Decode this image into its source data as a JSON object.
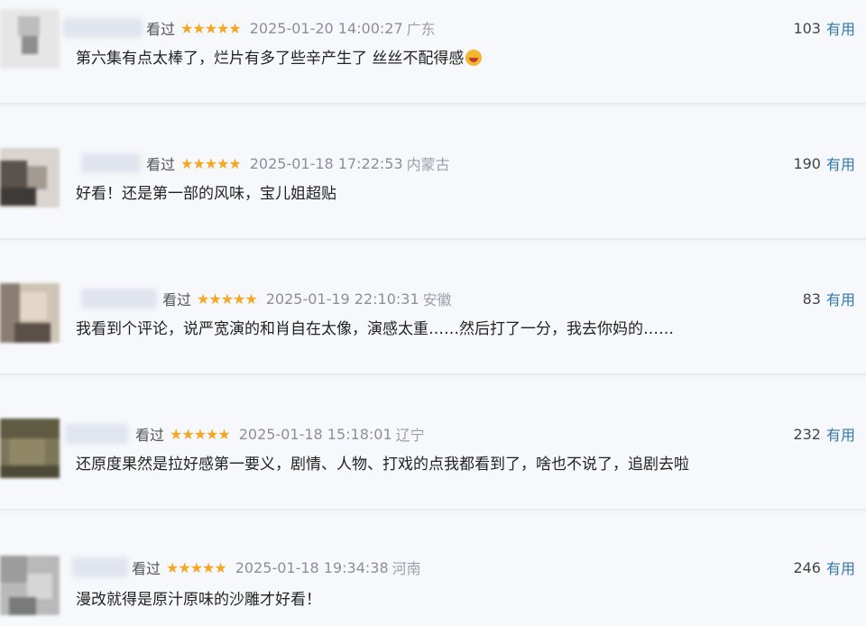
{
  "comments": [
    {
      "seen": "看过",
      "stars": "★★★★★",
      "date": "2025-01-20 14:00:27",
      "region": "广东",
      "useful_count": "103",
      "useful_label": "有用",
      "text": "第六集有点太棒了，烂片有多了些辛产生了   丝丝不配得感"
    },
    {
      "seen": "看过",
      "stars": "★★★★★",
      "date": "2025-01-18 17:22:53",
      "region": "内蒙古",
      "useful_count": "190",
      "useful_label": "有用",
      "text": "好看！还是第一部的风味，宝儿姐超贴"
    },
    {
      "seen": "看过",
      "stars": "★★★★★",
      "date": "2025-01-19 22:10:31",
      "region": "安徽",
      "useful_count": "83",
      "useful_label": "有用",
      "text": "我看到个评论，说严宽演的和肖自在太像，演感太重……然后打了一分，我去你妈的……"
    },
    {
      "seen": "看过",
      "stars": "★★★★★",
      "date": "2025-01-18 15:18:01",
      "region": "辽宁",
      "useful_count": "232",
      "useful_label": "有用",
      "text": "还原度果然是拉好感第一要义，剧情、人物、打戏的点我都看到了，啥也不说了，追剧去啦"
    },
    {
      "seen": "看过",
      "stars": "★★★★★",
      "date": "2025-01-18 19:34:38",
      "region": "河南",
      "useful_count": "246",
      "useful_label": "有用",
      "text": "漫改就得是原汁原味的沙雕才好看！"
    }
  ]
}
